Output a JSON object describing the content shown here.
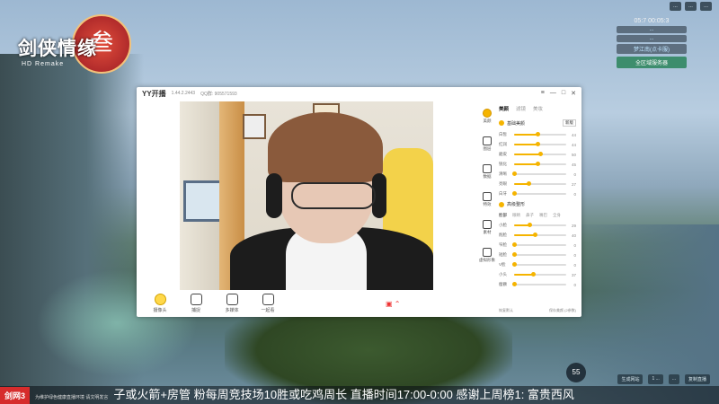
{
  "game": {
    "logo_title": "剑侠情缘",
    "logo_seal": "叁",
    "logo_sub": "HD Remake"
  },
  "hud": {
    "top_chips": [
      "...",
      "...",
      "..."
    ],
    "time": "05:7 00:05:3",
    "lines": [
      "...",
      "...",
      "梦江南(点卡服)"
    ],
    "button": "全区域服务器"
  },
  "window": {
    "app_name": "YY开播",
    "version": "1.44.2.2443",
    "qq": "QQ群: 905571593",
    "controls": [
      "≡",
      "—",
      "□",
      "✕"
    ]
  },
  "toolbar": [
    {
      "label": "摄像头",
      "active": true
    },
    {
      "label": "捕捉",
      "active": false
    },
    {
      "label": "多媒体",
      "active": false
    },
    {
      "label": "一起看",
      "active": false
    }
  ],
  "sidebar": [
    {
      "label": "美颜",
      "active": true
    },
    {
      "label": "图层",
      "active": false
    },
    {
      "label": "数据",
      "active": false
    },
    {
      "label": "特效",
      "active": false
    },
    {
      "label": "素材",
      "active": false
    },
    {
      "label": "虚拟形象",
      "active": false
    }
  ],
  "panel": {
    "tabs": [
      {
        "label": "美颜",
        "on": true
      },
      {
        "label": "滤镜",
        "on": false
      },
      {
        "label": "美妆",
        "on": false
      }
    ],
    "section1": {
      "title": "基础美颜",
      "select": "新版"
    },
    "sliders1": [
      {
        "label": "白皙",
        "value": 44
      },
      {
        "label": "红润",
        "value": 44
      },
      {
        "label": "磨皮",
        "value": 50
      },
      {
        "label": "锐化",
        "value": 45
      },
      {
        "label": "清晰",
        "value": 0
      },
      {
        "label": "亮眼",
        "value": 27
      },
      {
        "label": "白牙",
        "value": 0
      }
    ],
    "section2": {
      "title": "高级整形"
    },
    "subtabs": [
      {
        "label": "脸部",
        "on": true
      },
      {
        "label": "眼睛",
        "on": false
      },
      {
        "label": "鼻子",
        "on": false
      },
      {
        "label": "嘴巴",
        "on": false
      },
      {
        "label": "全身",
        "on": false
      }
    ],
    "sliders2": [
      {
        "label": "小脸",
        "value": 29
      },
      {
        "label": "削脸",
        "value": 40
      },
      {
        "label": "窄脸",
        "value": 0
      },
      {
        "label": "短脸",
        "value": 0
      },
      {
        "label": "V脸",
        "value": 0
      },
      {
        "label": "小头",
        "value": 37
      },
      {
        "label": "瘦颧",
        "value": 0
      }
    ],
    "foot_left": "恢复默认",
    "foot_right": "保存美颜 (2参数)"
  },
  "ticker": {
    "brand": "剑网3",
    "small": "为维护绿色健康直播环境 请文明发言",
    "text": "子或火箭+房管 粉每周竞技场10胜或吃鸡周长 直播时间17:00-0:00 感谢上周榜1: 富贵西风"
  },
  "fps": "55",
  "bottom_chips": [
    "生成网站",
    "1 ...",
    "...",
    "复制直播"
  ]
}
